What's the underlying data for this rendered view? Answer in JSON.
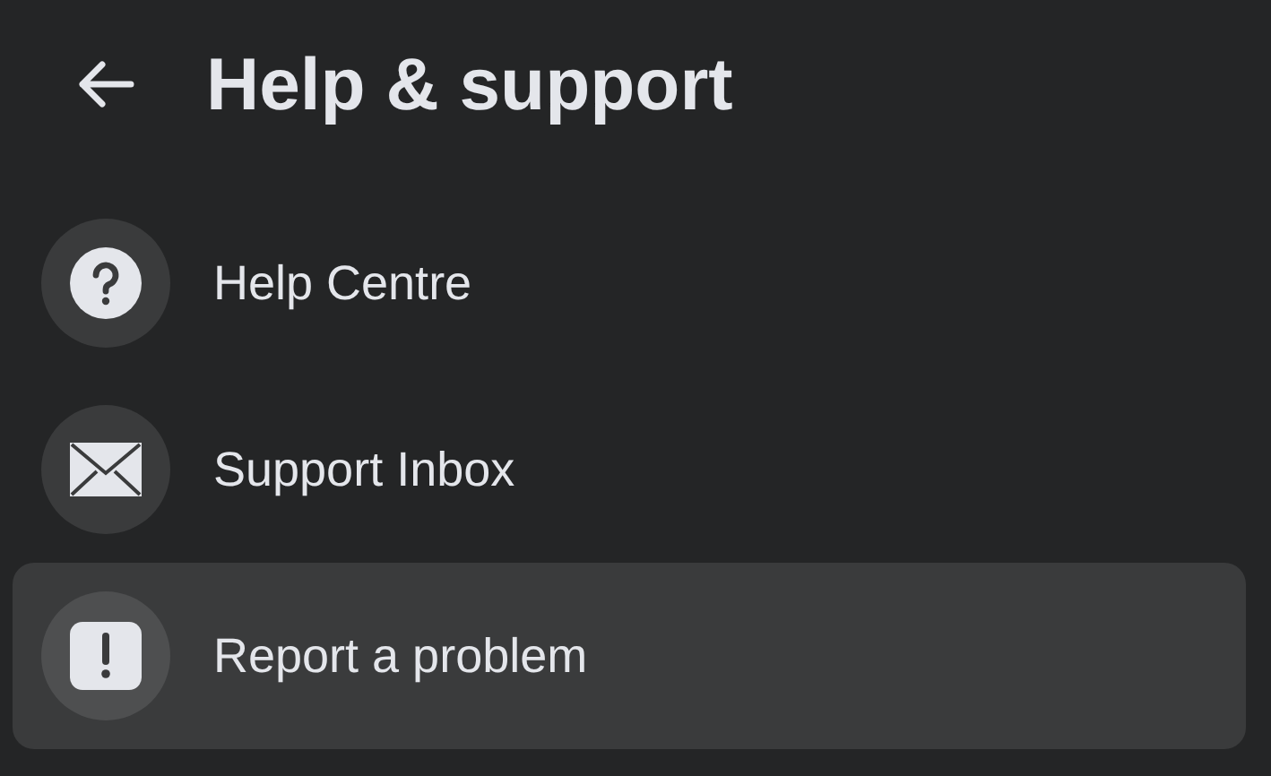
{
  "header": {
    "title": "Help & support"
  },
  "items": [
    {
      "kind": "help",
      "label": "Help Centre",
      "selected": false
    },
    {
      "kind": "mail",
      "label": "Support Inbox",
      "selected": false
    },
    {
      "kind": "alert",
      "label": "Report a problem",
      "selected": true
    }
  ]
}
